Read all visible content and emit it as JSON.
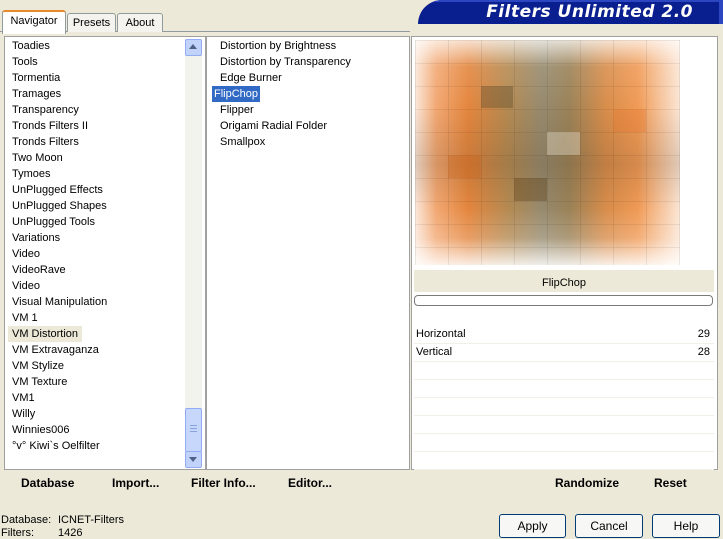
{
  "tabs": [
    {
      "label": "Navigator",
      "active": true
    },
    {
      "label": "Presets",
      "active": false
    },
    {
      "label": "About",
      "active": false
    }
  ],
  "banner": {
    "title": "Filters Unlimited 2.0"
  },
  "categories": [
    "Toadies",
    "Tools",
    "Tormentia",
    "Tramages",
    "Transparency",
    "Tronds Filters II",
    "Tronds Filters",
    "Two Moon",
    "Tymoes",
    "UnPlugged Effects",
    "UnPlugged Shapes",
    "UnPlugged Tools",
    "Variations",
    "Video",
    "VideoRave",
    "Video",
    "Visual Manipulation",
    "VM 1",
    "VM Distortion",
    "VM Extravaganza",
    "VM Stylize",
    "VM Texture",
    "VM1",
    "Willy",
    "Winnies006",
    "°v° Kiwi`s Oelfilter"
  ],
  "selected_category": "VM Distortion",
  "filters": [
    "Distortion by Brightness",
    "Distortion by Transparency",
    "Edge Burner",
    "FlipChop",
    "Flipper",
    "Origami Radial Folder",
    "Smallpox"
  ],
  "selected_filter": "FlipChop",
  "preview_label": "FlipChop",
  "params": [
    {
      "name": "Horizontal",
      "value": "29"
    },
    {
      "name": "Vertical",
      "value": "28"
    }
  ],
  "toolbar": {
    "database": "Database",
    "import": "Import...",
    "filter_info": "Filter Info...",
    "editor": "Editor...",
    "randomize": "Randomize",
    "reset": "Reset"
  },
  "status": {
    "database_label": "Database:",
    "database_value": "ICNET-Filters",
    "filters_label": "Filters:",
    "filters_value": "1426"
  },
  "buttons": {
    "apply": "Apply",
    "cancel": "Cancel",
    "help": "Help"
  },
  "colors": {
    "selection": "#316ac5",
    "banner": "#0a1f8f",
    "tab_accent": "#e68b2c"
  }
}
